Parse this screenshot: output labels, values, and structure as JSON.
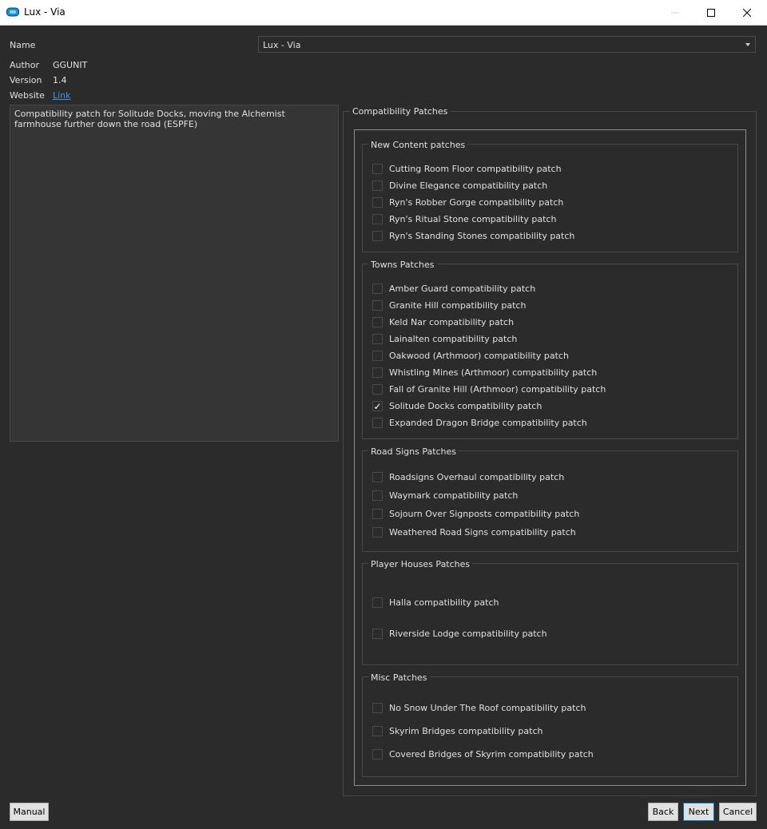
{
  "window": {
    "title": "Lux - Via",
    "icon": "mod-organizer-icon",
    "controls": [
      "minimize-icon",
      "maximize-icon",
      "close-icon"
    ]
  },
  "info": {
    "name_label": "Name",
    "name_value": "Lux - Via",
    "author_label": "Author",
    "author_value": "GGUNIT",
    "version_label": "Version",
    "version_value": "1.4",
    "website_label": "Website",
    "website_link": "Link"
  },
  "description": "Compatibility patch for Solitude Docks, moving the Alchemist farmhouse further down the road (ESPFE)",
  "patches": {
    "title": "Compatibility Patches",
    "groups": [
      {
        "title": "New Content patches",
        "options": [
          {
            "label": "Cutting Room Floor compatibility patch",
            "checked": false
          },
          {
            "label": "Divine Elegance compatibility patch",
            "checked": false
          },
          {
            "label": "Ryn's Robber Gorge compatibility patch",
            "checked": false
          },
          {
            "label": "Ryn's Ritual Stone compatibility patch",
            "checked": false
          },
          {
            "label": "Ryn's Standing Stones compatibility patch",
            "checked": false
          }
        ]
      },
      {
        "title": "Towns Patches",
        "options": [
          {
            "label": "Amber Guard compatibility patch",
            "checked": false
          },
          {
            "label": "Granite Hill compatibility patch",
            "checked": false
          },
          {
            "label": "Keld Nar compatibility patch",
            "checked": false
          },
          {
            "label": "Lainalten compatibility patch",
            "checked": false
          },
          {
            "label": "Oakwood (Arthmoor) compatibility patch",
            "checked": false
          },
          {
            "label": "Whistling Mines (Arthmoor) compatibility patch",
            "checked": false
          },
          {
            "label": "Fall of Granite Hill (Arthmoor) compatibility patch",
            "checked": false
          },
          {
            "label": "Solitude Docks compatibility patch",
            "checked": true
          },
          {
            "label": "Expanded Dragon Bridge compatibility patch",
            "checked": false
          }
        ]
      },
      {
        "title": "Road Signs Patches",
        "options": [
          {
            "label": "Roadsigns Overhaul compatibility patch",
            "checked": false
          },
          {
            "label": "Waymark compatibility patch",
            "checked": false
          },
          {
            "label": "Sojourn Over Signposts compatibility patch",
            "checked": false
          },
          {
            "label": "Weathered Road Signs compatibility patch",
            "checked": false
          }
        ]
      },
      {
        "title": "Player Houses Patches",
        "options": [
          {
            "label": "Halla compatibility patch",
            "checked": false
          },
          {
            "label": "Riverside Lodge compatibility patch",
            "checked": false
          }
        ]
      },
      {
        "title": "Misc Patches",
        "options": [
          {
            "label": "No Snow Under The Roof compatibility patch",
            "checked": false
          },
          {
            "label": "Skyrim Bridges compatibility patch",
            "checked": false
          },
          {
            "label": "Covered Bridges of Skyrim compatibility patch",
            "checked": false
          }
        ]
      }
    ]
  },
  "buttons": {
    "manual": "Manual",
    "back": "Back",
    "next": "Next",
    "cancel": "Cancel"
  },
  "colors": {
    "background": "#2b2b2b",
    "link": "#3d95e6",
    "focus_border": "#0078d7"
  }
}
